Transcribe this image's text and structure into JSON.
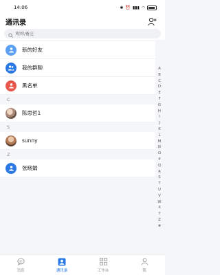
{
  "status_bar": {
    "time": "14:06"
  },
  "header": {
    "title": "通讯录"
  },
  "search": {
    "placeholder": "昵称/备注"
  },
  "top_items": [
    {
      "label": "新的好友"
    },
    {
      "label": "我的群聊"
    },
    {
      "label": "黑名单"
    }
  ],
  "sections": [
    {
      "letter": "C",
      "contacts": [
        {
          "name": "陈思哲1"
        }
      ]
    },
    {
      "letter": "S",
      "contacts": [
        {
          "name": "sunny"
        }
      ]
    },
    {
      "letter": "Z",
      "contacts": [
        {
          "name": "张晓娟"
        }
      ]
    }
  ],
  "index_letters": [
    "A",
    "B",
    "C",
    "D",
    "E",
    "F",
    "G",
    "H",
    "I",
    "J",
    "K",
    "L",
    "M",
    "N",
    "O",
    "P",
    "Q",
    "R",
    "S",
    "T",
    "U",
    "V",
    "W",
    "X",
    "Y",
    "Z",
    "#"
  ],
  "tabs": [
    {
      "label": "消息"
    },
    {
      "label": "通讯录"
    },
    {
      "label": "工作台"
    },
    {
      "label": "我"
    }
  ],
  "colors": {
    "accent": "#2a78e4",
    "blocked": "#e8574c"
  }
}
